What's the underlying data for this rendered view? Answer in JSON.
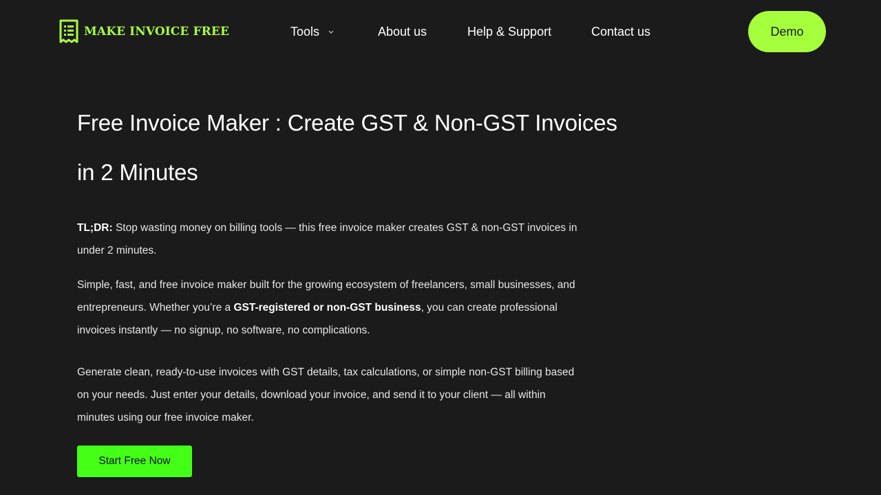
{
  "brand": {
    "name": "MAKE INVOICE FREE",
    "accent_color": "#aaff3f",
    "icon": "receipt-icon"
  },
  "nav": {
    "items": [
      {
        "label": "Tools",
        "icon": "chevron-down-icon"
      },
      {
        "label": "About us"
      },
      {
        "label": "Help & Support"
      },
      {
        "label": "Contact us"
      }
    ],
    "demo_label": "Demo",
    "demo_color": "#a6ff3d"
  },
  "hero": {
    "title": "Free Invoice Maker : Create GST & Non-GST Invoices in 2 Minutes",
    "tldr_label": "TL;DR:",
    "tldr_text": " Stop wasting money on billing tools — this free invoice maker creates GST & non-GST invoices in under 2 minutes.",
    "p2_before": "Simple, fast, and free invoice maker built for the growing ecosystem of freelancers, small businesses, and entrepreneurs. Whether you’re a ",
    "p2_bold": "GST-registered or non-GST business",
    "p2_after": ", you can create professional invoices instantly — no signup, no software, no complications.",
    "p3": "Generate clean, ready-to-use invoices with GST details, tax calculations, or simple non-GST billing based on your needs. Just enter your details, download your invoice, and send it to your client — all within minutes using our free invoice maker.",
    "cta_label": "Start Free Now",
    "cta_color": "#44ff16"
  },
  "theme": {
    "background": "#1b1b1c",
    "text": "#ffffff"
  }
}
